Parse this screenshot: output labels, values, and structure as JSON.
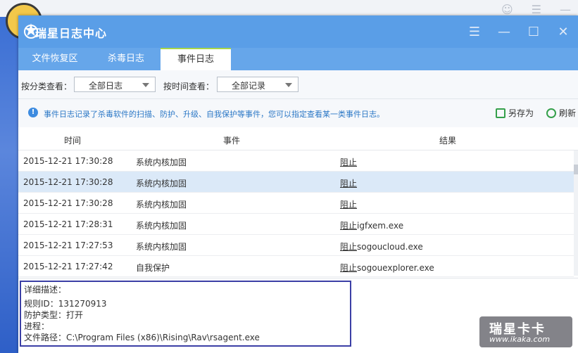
{
  "app": {
    "title": "瑞星日志中心"
  },
  "tabs": [
    {
      "label": "文件恢复区"
    },
    {
      "label": "杀毒日志"
    },
    {
      "label": "事件日志"
    }
  ],
  "filters": {
    "category_label": "按分类查看：",
    "category_value": "全部日志",
    "time_label": "按时间查看：",
    "time_value": "全部记录"
  },
  "info": {
    "text": "事件日志记录了杀毒软件的扫描、防护、升级、自我保护等事件，您可以指定查看某一类事件日志。",
    "save_as": "另存为",
    "refresh": "刷新"
  },
  "table": {
    "headers": [
      "时间",
      "事件",
      "结果"
    ],
    "rows": [
      {
        "time": "2015-12-21 17:30:28",
        "event": "系统内核加固",
        "result_action": "阻止",
        "result_target": ""
      },
      {
        "time": "2015-12-21 17:30:28",
        "event": "系统内核加固",
        "result_action": "阻止",
        "result_target": ""
      },
      {
        "time": "2015-12-21 17:30:28",
        "event": "系统内核加固",
        "result_action": "阻止",
        "result_target": ""
      },
      {
        "time": "2015-12-21 17:28:31",
        "event": "系统内核加固",
        "result_action": "阻止",
        "result_target": "igfxem.exe"
      },
      {
        "time": "2015-12-21 17:27:53",
        "event": "系统内核加固",
        "result_action": "阻止",
        "result_target": "sogoucloud.exe"
      },
      {
        "time": "2015-12-21 17:27:42",
        "event": "自我保护",
        "result_action": "阻止",
        "result_target": "sogouexplorer.exe"
      }
    ]
  },
  "detail": {
    "heading": "详细描述：",
    "rule_id": "规则ID：131270913",
    "protect_type": "防护类型：打开",
    "process": "进程：",
    "file_path": "文件路径：C:\\Program Files (x86)\\Rising\\Rav\\rsagent.exe"
  },
  "watermark": {
    "line1": "瑞星卡卡",
    "line2": "www.ikaka.com"
  },
  "colors": {
    "titlebar": "#5a9ee7",
    "tabbar": "#66a6ea",
    "selected_row": "#dbe9f8",
    "info_text": "#2c78c6"
  }
}
